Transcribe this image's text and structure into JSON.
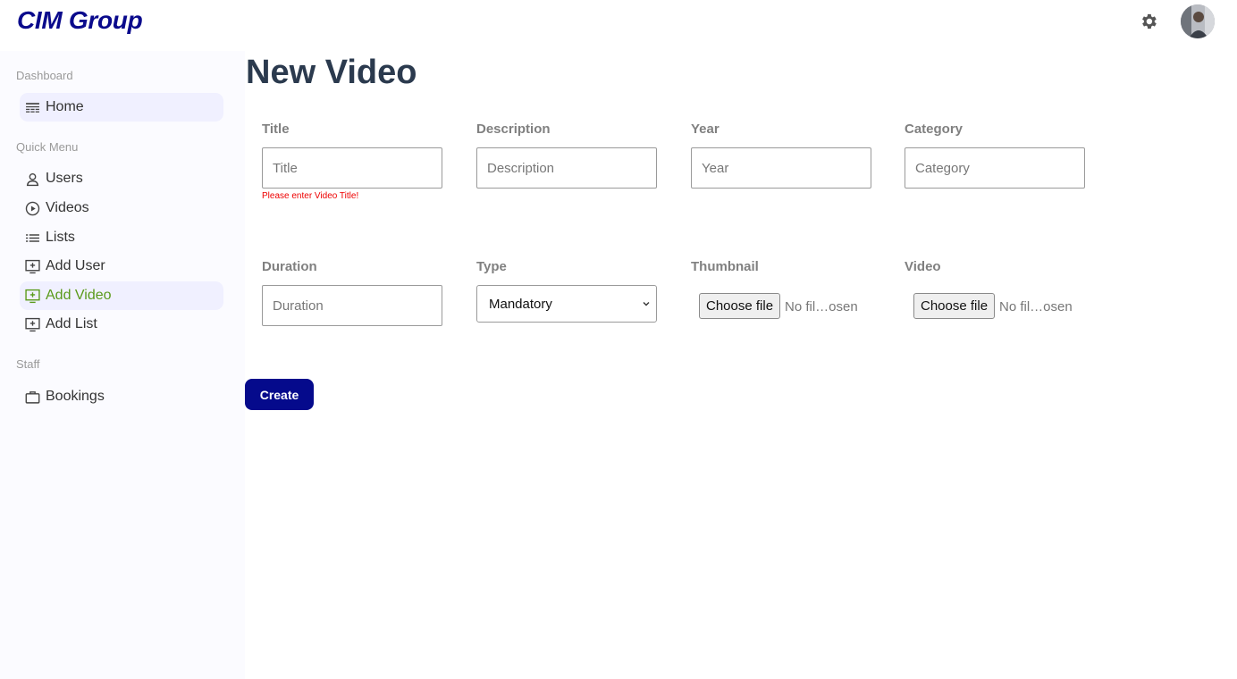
{
  "header": {
    "logo": "CIM Group",
    "icons": [
      "gear-icon",
      "avatar"
    ]
  },
  "sidebar": {
    "sections": [
      {
        "title": "Dashboard",
        "items": [
          {
            "label": "Home",
            "icon": "layout-icon"
          }
        ]
      },
      {
        "title": "Quick Menu",
        "items": [
          {
            "label": "Users",
            "icon": "user-icon"
          },
          {
            "label": "Videos",
            "icon": "play-circle-icon"
          },
          {
            "label": "Lists",
            "icon": "list-icon"
          },
          {
            "label": "Add User",
            "icon": "add-screen-icon"
          },
          {
            "label": "Add Video",
            "icon": "add-screen-icon",
            "active": true
          },
          {
            "label": "Add List",
            "icon": "add-screen-icon"
          }
        ]
      },
      {
        "title": "Staff",
        "items": [
          {
            "label": "Bookings",
            "icon": "briefcase-icon"
          }
        ]
      }
    ]
  },
  "form": {
    "title": "New Video",
    "fields": {
      "title": {
        "label": "Title",
        "placeholder": "Title",
        "error": "Please enter Video Title!"
      },
      "description": {
        "label": "Description",
        "placeholder": "Description"
      },
      "year": {
        "label": "Year",
        "placeholder": "Year"
      },
      "category": {
        "label": "Category",
        "placeholder": "Category"
      },
      "duration": {
        "label": "Duration",
        "placeholder": "Duration"
      },
      "type": {
        "label": "Type",
        "value": "Mandatory"
      },
      "thumbnail": {
        "label": "Thumbnail",
        "button": "Choose file",
        "status": "No fil…osen"
      },
      "video": {
        "label": "Video",
        "button": "Choose file",
        "status": "No fil…osen"
      }
    },
    "submit_label": "Create"
  },
  "colors": {
    "brand": "#0a0a8c",
    "active_nav": "#5a9a1a",
    "error": "#e00000",
    "title": "#2b3a4e"
  }
}
